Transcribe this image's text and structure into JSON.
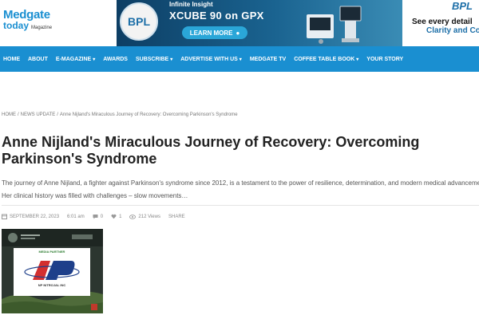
{
  "logo": {
    "line1": "Medgate",
    "line2": "today",
    "magazine": "Magazine"
  },
  "ad": {
    "brand": "BPL",
    "subtitle": "Infinite Insight",
    "title": "XCUBE 90 on GPX",
    "button": "LEARN MORE",
    "colors": {
      "bg": "#0d3e64",
      "button": "#2aa6d8"
    }
  },
  "ad2": {
    "brand": "BPL",
    "line1": "See every detail",
    "line2": "Clarity and Co"
  },
  "nav": {
    "items": [
      {
        "label": "HOME",
        "dropdown": false
      },
      {
        "label": "ABOUT",
        "dropdown": false
      },
      {
        "label": "E-MAGAZINE",
        "dropdown": true
      },
      {
        "label": "AWARDS",
        "dropdown": false
      },
      {
        "label": "SUBSCRIBE",
        "dropdown": true
      },
      {
        "label": "ADVERTISE WITH US",
        "dropdown": true
      },
      {
        "label": "MEDGATE TV",
        "dropdown": false
      },
      {
        "label": "COFFEE TABLE BOOK",
        "dropdown": true
      },
      {
        "label": "YOUR STORY",
        "dropdown": false
      }
    ],
    "color": "#1a8fd1"
  },
  "breadcrumb": {
    "home": "HOME",
    "section": "NEWS UPDATE",
    "current": "Anne Nijland's Miraculous Journey of Recovery: Overcoming Parkinson's Syndrome"
  },
  "article": {
    "title": "Anne Nijland's Miraculous Journey of Recovery: Overcoming Parkinson's Syndrome",
    "excerpt": "The journey of Anne Nijland, a fighter against Parkinson's syndrome since 2012, is a testament to the power of resilience, determination, and modern medical advancements. Her clinical history was filled with challenges – slow movements…",
    "meta": {
      "date": "SEPTEMBER 22, 2023",
      "time": "6:01 am",
      "comments": "0",
      "likes": "1",
      "views": "212 Views",
      "share": "SHARE"
    },
    "image": {
      "tag": "MEDIA PARTNER",
      "brand": "NP",
      "brand_sub": "NITROJAL INC"
    }
  }
}
